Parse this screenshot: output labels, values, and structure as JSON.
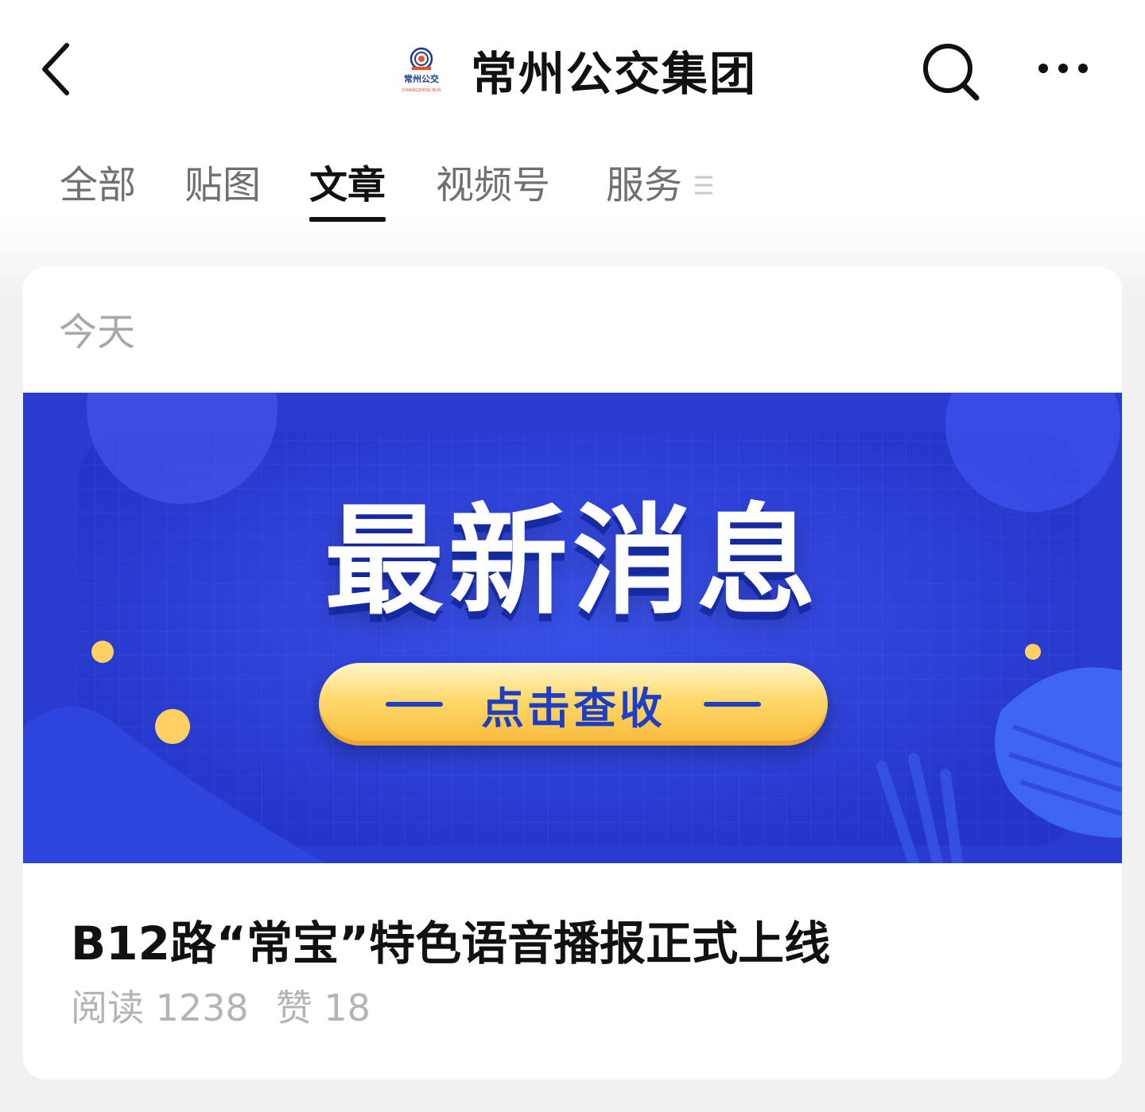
{
  "header": {
    "account_name": "常州公交集团",
    "logo_text": "常州公交",
    "logo_subtext": "CHANGZHOU BUS",
    "back_icon": "chevron-left-icon",
    "search_icon": "search-icon",
    "more_icon": "more-horizontal-icon"
  },
  "tabs": [
    {
      "label": "全部",
      "active": false
    },
    {
      "label": "贴图",
      "active": false
    },
    {
      "label": "文章",
      "active": true
    },
    {
      "label": "视频号",
      "active": false
    },
    {
      "label": "服务",
      "active": false
    }
  ],
  "feed": {
    "date_group": "今天",
    "article": {
      "banner_headline": "最新消息",
      "banner_cta": "点击查收",
      "title": "B12路“常宝”特色语音播报正式上线",
      "reads_label": "阅读",
      "reads_count": "1238",
      "likes_label": "赞",
      "likes_count": "18"
    }
  },
  "colors": {
    "banner_blue": "#2b40d6",
    "cta_yellow": "#ffd86a",
    "tab_active": "#111111",
    "tab_inactive": "#707070",
    "meta_gray": "#b4b4b4"
  }
}
